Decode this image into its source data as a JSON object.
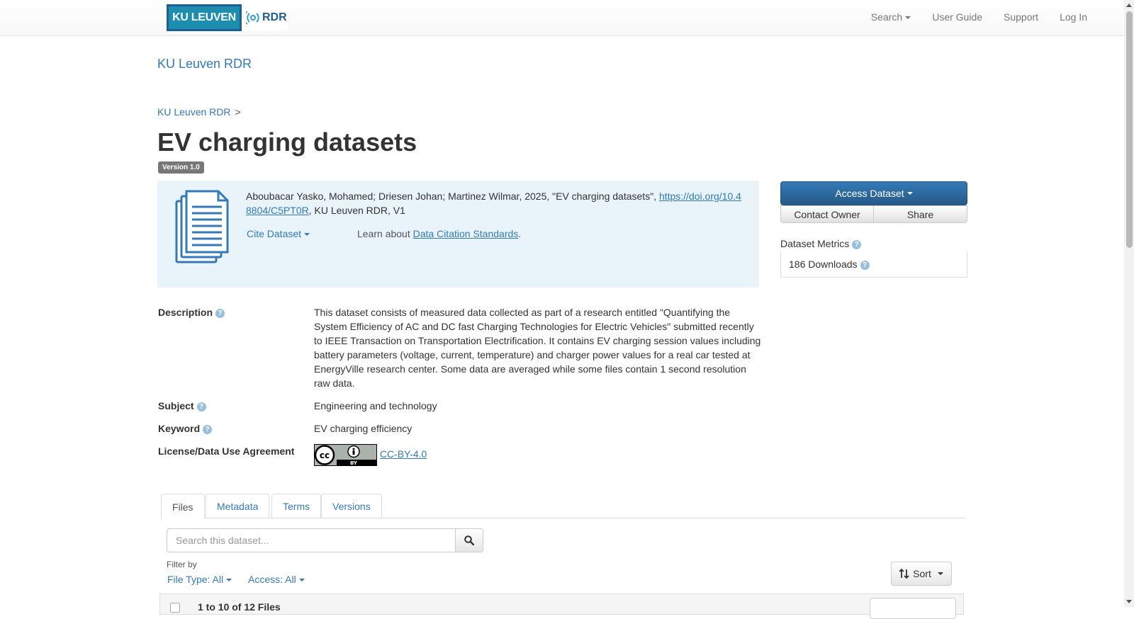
{
  "navbar": {
    "logo_left": "KU LEUVEN",
    "logo_right": "RDR",
    "search_label": "Search",
    "user_guide": "User Guide",
    "support": "Support",
    "login": "Log In"
  },
  "brand": "KU Leuven RDR",
  "breadcrumb": {
    "item": "KU Leuven RDR",
    "separator": ">"
  },
  "dataset": {
    "title": "EV charging datasets",
    "version": "Version 1.0"
  },
  "citation": {
    "text_before": "Aboubacar Yasko, Mohamed; Driesen Johan; Martinez Wilmar, 2025, \"EV charging datasets\", ",
    "doi": "https://doi.org/10.48804/C5PT0R",
    "text_after": ", KU Leuven RDR, V1",
    "cite_button": "Cite Dataset",
    "learn_text": "Learn about ",
    "learn_link": "Data Citation Standards",
    "learn_suffix": "."
  },
  "actions": {
    "access": "Access Dataset",
    "contact": "Contact Owner",
    "share": "Share"
  },
  "metrics": {
    "label": "Dataset Metrics",
    "downloads": "186 Downloads"
  },
  "fields": {
    "description_label": "Description",
    "description": "This dataset consists of measured data collected as part of a research entitled \"Quantifying the System Efficiency of AC and DC fast Charging Technologies for Electric Vehicles\" submitted recently to IEEE Transaction on Transportation Electrification. It contains EV charging session values including battery parameters (voltage, current, temperature) and charger power values for a real car tested at EnergyVille research center. Some data are averaged while some files contain 1 second resolution raw data.",
    "subject_label": "Subject",
    "subject": "Engineering and technology",
    "keyword_label": "Keyword",
    "keyword": "EV charging efficiency",
    "license_label": "License/Data Use Agreement",
    "license_badge_text": "BY",
    "license": "CC-BY-4.0"
  },
  "tabs": [
    "Files",
    "Metadata",
    "Terms",
    "Versions"
  ],
  "files": {
    "search_placeholder": "Search this dataset...",
    "filter_label": "Filter by",
    "filter_type": "File Type: All",
    "filter_access": "Access: All",
    "sort": "Sort",
    "count": "1 to 10 of 12 Files"
  }
}
